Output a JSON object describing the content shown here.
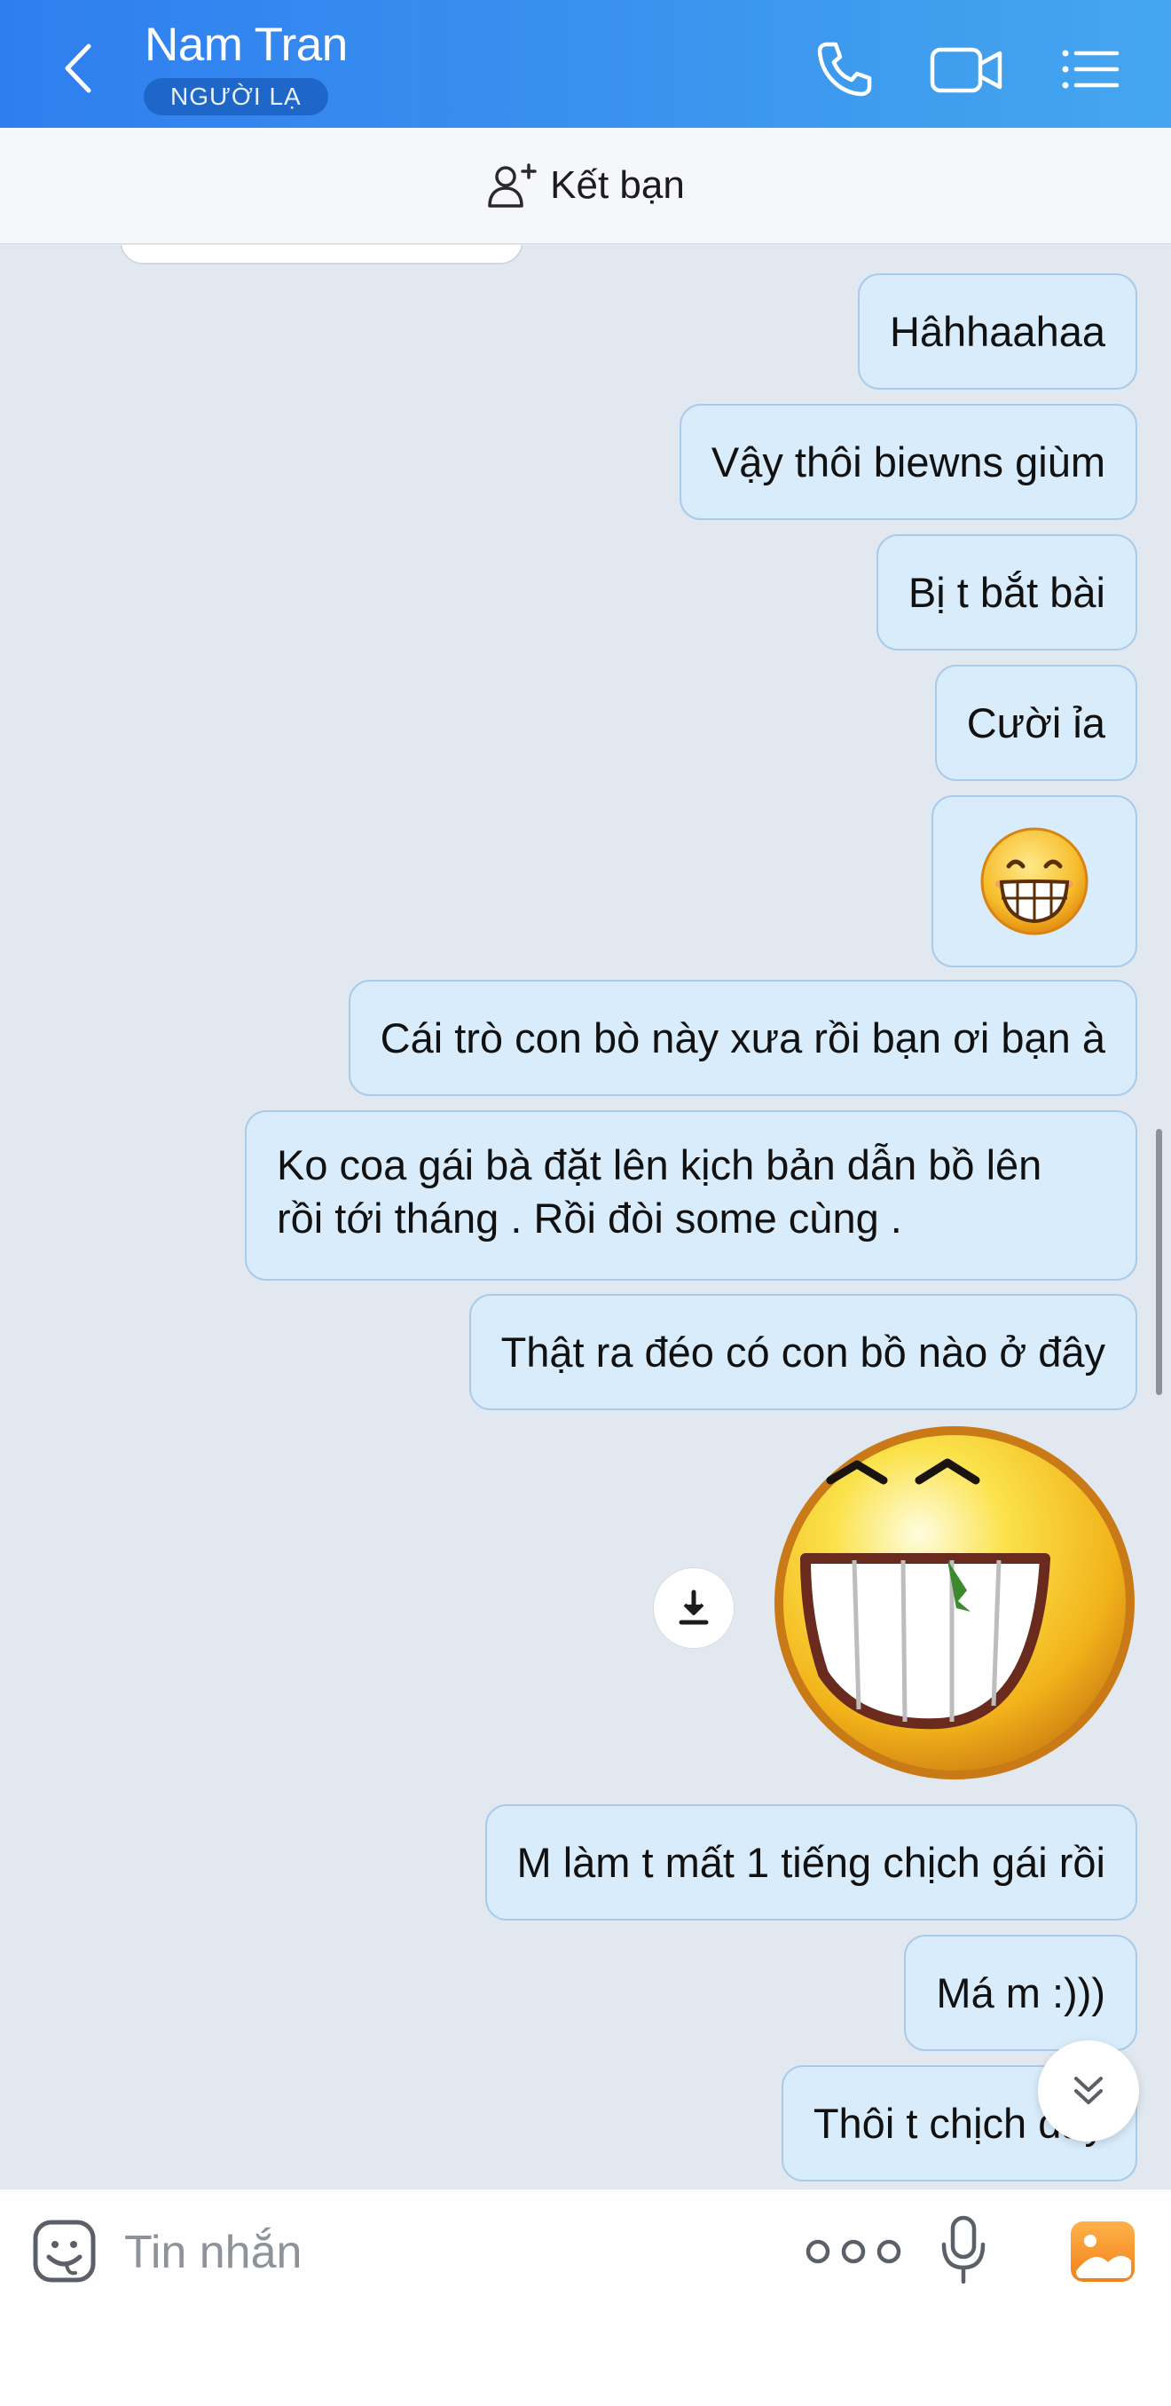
{
  "header": {
    "contact_name": "Nam Tran",
    "badge": "NGƯỜI LẠ",
    "back_icon": "chevron-left-icon",
    "call_icon": "phone-icon",
    "video_icon": "video-camera-icon",
    "menu_icon": "list-menu-icon",
    "background": "#2f7ef0"
  },
  "friend_bar": {
    "label": "Kết bạn",
    "icon": "add-person-icon"
  },
  "messages": [
    {
      "text": "Hâhhaahaa"
    },
    {
      "text": "Vậy thôi biewns giùm"
    },
    {
      "text": "Bị t bắt bài"
    },
    {
      "text": "Cười ỉa"
    },
    {
      "emoji": "grinning-emoji"
    },
    {
      "text": "Cái trò con bò này xưa rồi bạn ơi bạn à"
    },
    {
      "line1": "Ko coa gái bà đặt lên kịch bản dẫn bồ lên",
      "line2": "rồi tới tháng . Rồi đòi some cùng ."
    },
    {
      "text": "Thật ra đéo có con bồ nào ở đây"
    },
    {
      "sticker": "laughing-sticker"
    },
    {
      "text": "M làm t mất 1 tiếng chịch gái rồi"
    },
    {
      "text": "Má m :)))"
    },
    {
      "text": "Thôi t chịch đây"
    }
  ],
  "composer": {
    "placeholder": "Tin nhắn",
    "emoji_icon": "sticker-smile-icon",
    "more_icon": "more-dots-icon",
    "mic_icon": "microphone-icon",
    "image_icon": "image-icon"
  },
  "colors": {
    "bubble_bg": "#d8ecfc",
    "bubble_border": "#a9cbea",
    "chat_bg": "#e2e8f0",
    "accent": "#2f7ef0"
  }
}
